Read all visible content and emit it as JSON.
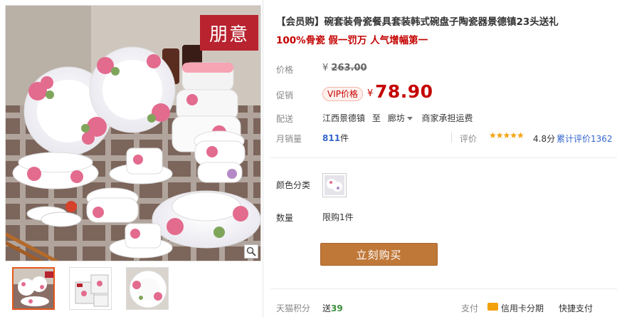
{
  "gallery": {
    "brand_mark": "朋意",
    "icons": {
      "zoom": "magnifier-icon"
    },
    "thumbnails": [
      "thumbnail-1",
      "thumbnail-2",
      "thumbnail-3"
    ]
  },
  "product": {
    "title": "【会员购】碗套装骨瓷餐具套装韩式碗盘子陶瓷器景德镇23头送礼",
    "subtitle": "100%骨瓷 假一罚万 人气增幅第一"
  },
  "price": {
    "label": "价格",
    "original": "263.00",
    "currency": "¥"
  },
  "promo": {
    "label": "促销",
    "badge": "VIP价格",
    "currency": "¥",
    "value": "78.90"
  },
  "shipping": {
    "label": "配送",
    "from": "江西景德镇",
    "to_word": "至",
    "destination": "廊坊",
    "fee": "商家承担运费"
  },
  "sales": {
    "label": "月销量",
    "count": "811",
    "unit": "件",
    "rating_label": "评价",
    "stars": "★★★★★",
    "score": "4.8分",
    "review_text": "累计评价1362"
  },
  "options": {
    "color_label": "颜色分类",
    "quantity_label": "数量",
    "quantity_limit": "限购1件"
  },
  "actions": {
    "buy_now": "立刻购买"
  },
  "footer": {
    "points_label": "天猫积分",
    "points_prefix": "送",
    "points_value": "39",
    "pay_label": "支付",
    "credit_card": "信用卡分期",
    "quick_pay": "快捷支付"
  },
  "colors": {
    "accent_red": "#c40000",
    "buy_button": "#c07838",
    "star": "#f2a20d",
    "link": "#3366cc"
  }
}
